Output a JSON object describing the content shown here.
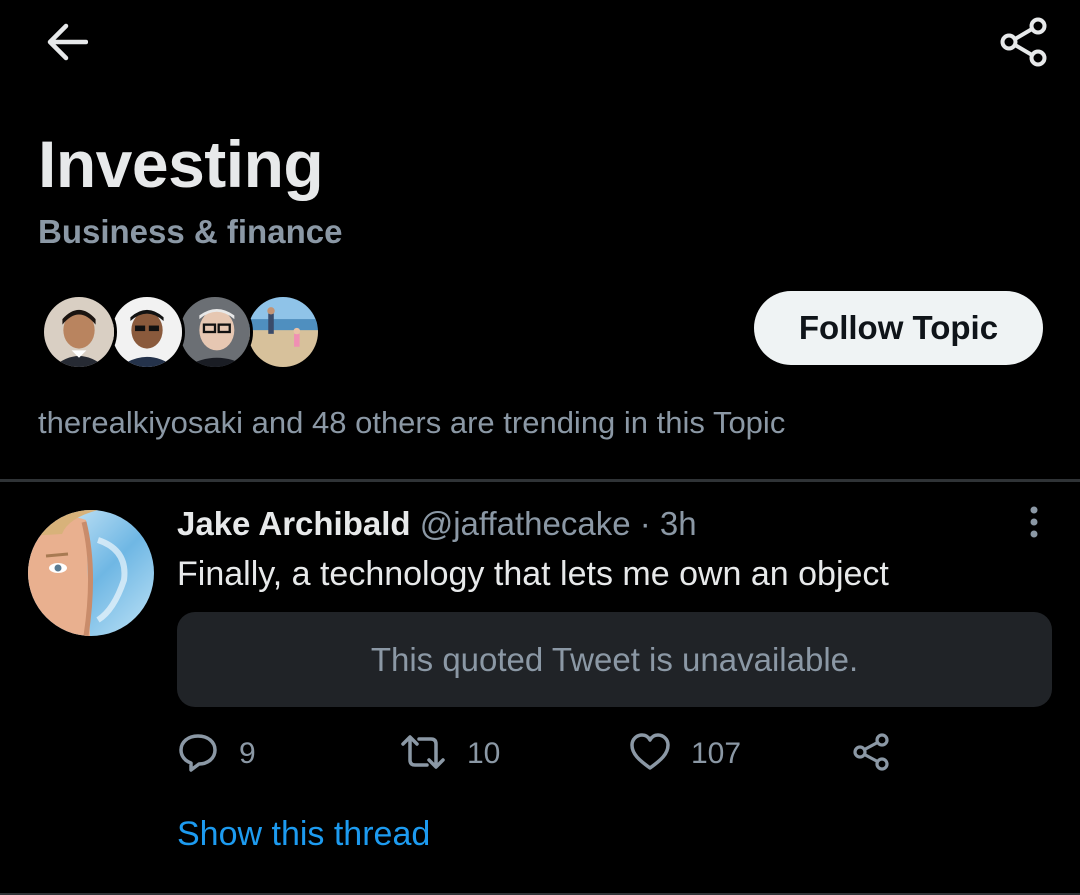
{
  "topbar": {
    "back_icon": "arrow-left-icon",
    "share_icon": "share-nodes-icon"
  },
  "header": {
    "title": "Investing",
    "subtitle": "Business & finance"
  },
  "avatars": [
    "avatar-1",
    "avatar-2",
    "avatar-3",
    "avatar-4"
  ],
  "follow_button": {
    "label": "Follow Topic"
  },
  "trending_text": "therealkiyosaki and 48 others are trending in this Topic",
  "tweet": {
    "name": "Jake Archibald",
    "handle": "@jaffathecake",
    "separator": "·",
    "time": "3h",
    "text": "Finally, a technology that lets me own an object",
    "quoted_unavailable": "This quoted Tweet is unavailable.",
    "actions": {
      "replies": "9",
      "retweets": "10",
      "likes": "107"
    },
    "show_thread": "Show this thread"
  },
  "colors": {
    "background": "#000000",
    "primary_text": "#e7e9ea",
    "secondary_text": "#8b98a5",
    "link": "#1d9bf0",
    "button_bg": "#eff3f4",
    "quote_bg": "#202327"
  }
}
